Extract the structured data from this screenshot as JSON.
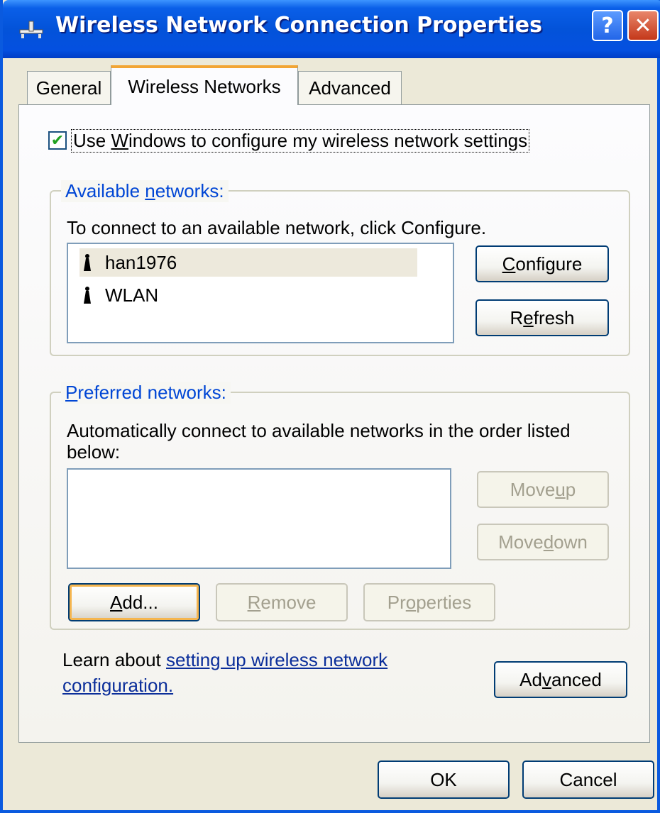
{
  "window": {
    "title": "Wireless Network Connection Properties",
    "help_label": "?",
    "close_label": "✕"
  },
  "tabs": [
    "General",
    "Wireless Networks",
    "Advanced"
  ],
  "checkbox": {
    "checked": true,
    "label_pre": "Use ",
    "label_accel": "W",
    "label_post": "indows to configure my wireless network settings"
  },
  "available": {
    "legend_pre": "Available ",
    "legend_accel": "n",
    "legend_post": "etworks:",
    "instruction": "To connect to an available network, click Configure.",
    "networks": [
      "han1976",
      "WLAN"
    ],
    "configure": {
      "accel": "C",
      "rest": "onfigure"
    },
    "refresh": {
      "pre": "R",
      "accel": "e",
      "rest": "fresh"
    }
  },
  "preferred": {
    "legend_accel": "P",
    "legend_post": "referred networks:",
    "instruction_line1": "Automatically connect to available networks in the order listed",
    "instruction_line2": "below:",
    "move_up": {
      "pre": "Move ",
      "accel": "u",
      "rest": "p"
    },
    "move_down": {
      "pre": "Move ",
      "accel": "d",
      "rest": "own"
    },
    "add": {
      "accel": "A",
      "rest": "dd..."
    },
    "remove": {
      "accel": "R",
      "rest": "emove"
    },
    "properties": {
      "pre": "Pr",
      "accel": "o",
      "rest": "perties"
    }
  },
  "learn": {
    "prefix": "Learn about ",
    "link_line1": "setting up wireless network",
    "link_line2": "configuration."
  },
  "advanced_button": {
    "pre": "Ad",
    "accel": "v",
    "rest": "anced"
  },
  "footer": {
    "ok": "OK",
    "cancel": "Cancel"
  },
  "colors": {
    "titlebar": "#0353D9",
    "face": "#ECE9D8",
    "legend": "#0046D5",
    "link": "#0B2E9A"
  }
}
